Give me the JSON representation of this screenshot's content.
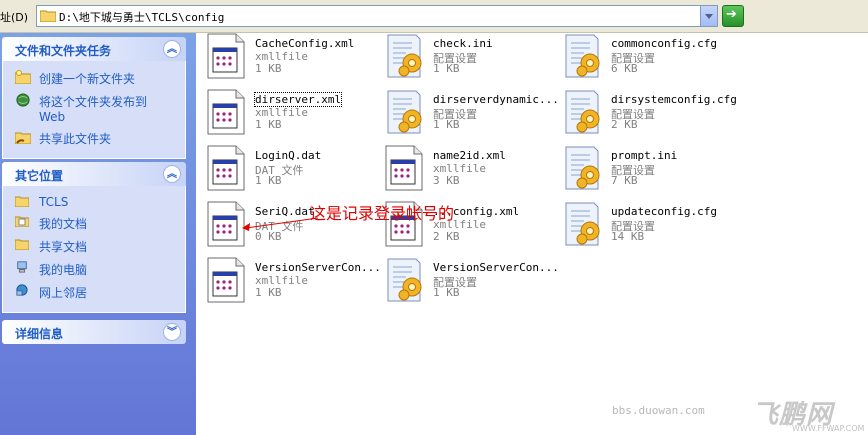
{
  "address": {
    "label": "址(D)",
    "path": "D:\\地下城与勇士\\TCLS\\config"
  },
  "sidebar": {
    "tasks": {
      "title": "文件和文件夹任务",
      "items": [
        {
          "label": "创建一个新文件夹",
          "icon": "new-folder-icon"
        },
        {
          "label": "将这个文件夹发布到",
          "label2": "Web",
          "icon": "publish-web-icon"
        },
        {
          "label": "共享此文件夹",
          "icon": "share-folder-icon"
        }
      ]
    },
    "places": {
      "title": "其它位置",
      "items": [
        {
          "label": "TCLS",
          "icon": "folder-icon"
        },
        {
          "label": "我的文档",
          "icon": "my-documents-icon"
        },
        {
          "label": "共享文档",
          "icon": "shared-documents-icon"
        },
        {
          "label": "我的电脑",
          "icon": "my-computer-icon"
        },
        {
          "label": "网上邻居",
          "icon": "network-places-icon"
        }
      ]
    },
    "details": {
      "title": "详细信息"
    }
  },
  "files": [
    {
      "name": "CacheConfig.xml",
      "type": "xmllfile",
      "size": "1 KB",
      "kind": "xml"
    },
    {
      "name": "check.ini",
      "type": "配置设置",
      "size": "1 KB",
      "kind": "cfg"
    },
    {
      "name": "commonconfig.cfg",
      "type": "配置设置",
      "size": "6 KB",
      "kind": "cfg"
    },
    {
      "name": "dirserver.xml",
      "type": "xmllfile",
      "size": "1 KB",
      "kind": "xml"
    },
    {
      "name": "dirserverdynamic...",
      "type": "配置设置",
      "size": "1 KB",
      "kind": "cfg"
    },
    {
      "name": "dirsystemconfig.cfg",
      "type": "配置设置",
      "size": "2 KB",
      "kind": "cfg"
    },
    {
      "name": "LoginQ.dat",
      "type": "DAT 文件",
      "size": "1 KB",
      "kind": "xml"
    },
    {
      "name": "name2id.xml",
      "type": "xmllfile",
      "size": "3 KB",
      "kind": "xml"
    },
    {
      "name": "prompt.ini",
      "type": "配置设置",
      "size": "7 KB",
      "kind": "cfg"
    },
    {
      "name": "SeriQ.dat",
      "type": "DAT 文件",
      "size": "0 KB",
      "kind": "xml"
    },
    {
      "name": "...config.xml",
      "type": "xmllfile",
      "size": "2 KB",
      "kind": "xml"
    },
    {
      "name": "updateconfig.cfg",
      "type": "配置设置",
      "size": "14 KB",
      "kind": "cfg"
    },
    {
      "name": "VersionServerCon...",
      "type": "xmllfile",
      "size": "1 KB",
      "kind": "xml"
    },
    {
      "name": "VersionServerCon...",
      "type": "配置设置",
      "size": "1 KB",
      "kind": "cfg"
    }
  ],
  "annotation": "这是记录登录帐号的",
  "watermark": {
    "site": "bbs.duowan.com",
    "brand": "飞鹏网",
    "url": "WWW.FFWAP.COM"
  }
}
